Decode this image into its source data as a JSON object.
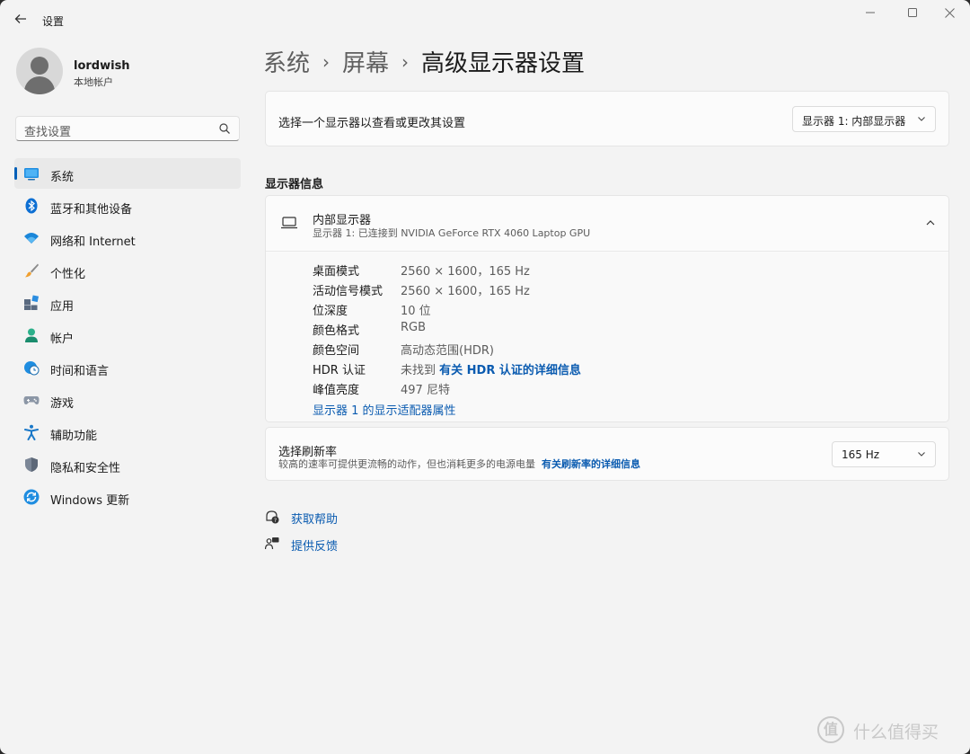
{
  "window": {
    "title": "设置"
  },
  "profile": {
    "name": "lordwish",
    "account_type": "本地帐户"
  },
  "search": {
    "placeholder": "查找设置"
  },
  "sidebar": {
    "items": [
      {
        "label": "系统",
        "icon": "system-icon",
        "active": true
      },
      {
        "label": "蓝牙和其他设备",
        "icon": "bluetooth-icon"
      },
      {
        "label": "网络和 Internet",
        "icon": "wifi-icon"
      },
      {
        "label": "个性化",
        "icon": "brush-icon"
      },
      {
        "label": "应用",
        "icon": "apps-icon"
      },
      {
        "label": "帐户",
        "icon": "person-icon"
      },
      {
        "label": "时间和语言",
        "icon": "globe-clock-icon"
      },
      {
        "label": "游戏",
        "icon": "gamepad-icon"
      },
      {
        "label": "辅助功能",
        "icon": "accessibility-icon"
      },
      {
        "label": "隐私和安全性",
        "icon": "shield-icon"
      },
      {
        "label": "Windows 更新",
        "icon": "update-icon"
      }
    ]
  },
  "breadcrumb": {
    "level1": "系统",
    "level2": "屏幕",
    "current": "高级显示器设置"
  },
  "display_select": {
    "label": "选择一个显示器以查看或更改其设置",
    "selected": "显示器 1: 内部显示器"
  },
  "display_info": {
    "section_title": "显示器信息",
    "title": "内部显示器",
    "subtitle": "显示器 1: 已连接到 NVIDIA GeForce RTX 4060 Laptop GPU",
    "rows": [
      {
        "key": "桌面模式",
        "value": "2560 × 1600，165 Hz"
      },
      {
        "key": "活动信号模式",
        "value": "2560 × 1600，165 Hz"
      },
      {
        "key": "位深度",
        "value": "10 位"
      },
      {
        "key": "颜色格式",
        "value": "RGB"
      },
      {
        "key": "颜色空间",
        "value": "高动态范围(HDR)"
      },
      {
        "key": "HDR 认证",
        "value": "未找到",
        "link": "有关 HDR 认证的详细信息"
      },
      {
        "key": "峰值亮度",
        "value": "497 尼特"
      }
    ],
    "adapter_link": "显示器 1 的显示适配器属性"
  },
  "refresh": {
    "title": "选择刷新率",
    "description": "较高的速率可提供更流畅的动作，但也消耗更多的电源电量",
    "link": "有关刷新率的详细信息",
    "selected": "165 Hz"
  },
  "help": {
    "get_help": "获取帮助",
    "feedback": "提供反馈"
  },
  "watermark": {
    "logo": "值",
    "text": "什么值得买"
  },
  "colors": {
    "accent": "#005fb8",
    "link": "#0a5bb0",
    "background": "#f3f3f3"
  }
}
